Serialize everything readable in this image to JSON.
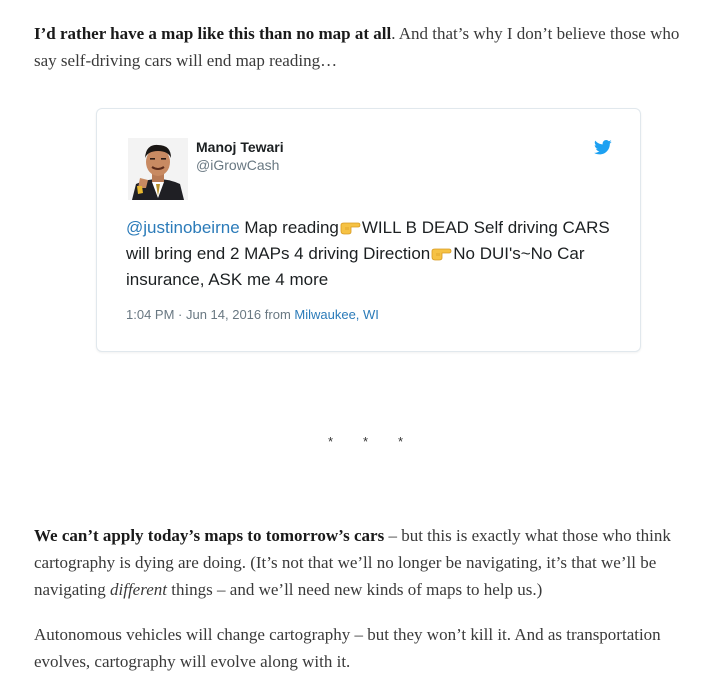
{
  "intro": {
    "bold": "I’d rather have a map like this than no map at all",
    "rest": ". And that’s why I don’t believe those who say self-driving cars will end map reading…"
  },
  "tweet": {
    "name": "Manoj Tewari",
    "handle": "@iGrowCash",
    "mention": "@justinobeirne",
    "text_part1": " Map reading",
    "text_part2": "WILL B DEAD Self driving CARS will bring end 2 MAPs 4 driving Direction",
    "text_part3": "No DUI's~No Car insurance, ASK me 4 more",
    "timestamp": "1:04 PM · Jun 14, 2016",
    "from_label": " from ",
    "location": "Milwaukee, WI",
    "icons": {
      "bird": "twitter-bird-icon",
      "pointing": "backhand-pointing-right-icon"
    },
    "colors": {
      "link": "#2b7bb9",
      "bird": "#1da1f2",
      "meta": "#697882"
    }
  },
  "divider": {
    "s1": "*",
    "s2": "*",
    "s3": "*"
  },
  "para2": {
    "bold": "We can’t apply today’s maps to tomorrow’s cars",
    "part1": " – but this is exactly what those who think cartography is dying are doing. (It’s not that we’ll no longer be navigating, it’s that we’ll be navigating ",
    "em": "different",
    "part2": " things – and we’ll need new kinds of maps to help us.)"
  },
  "para3": {
    "text": "Autonomous vehicles will change cartography – but they won’t kill it. And as transportation evolves, cartography will evolve along with it."
  }
}
